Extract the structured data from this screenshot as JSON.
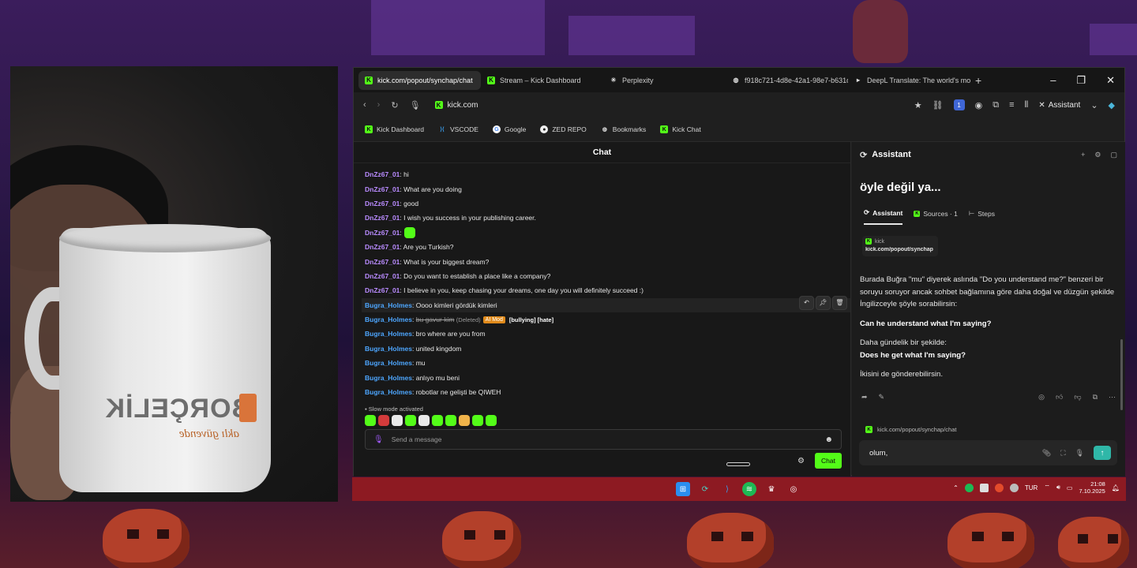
{
  "browser": {
    "tabs": [
      {
        "label": "kick.com/popout/synchap/chat",
        "active": true,
        "icon": "kick-icon"
      },
      {
        "label": "Stream – Kick Dashboard",
        "active": false,
        "icon": "kick-icon"
      },
      {
        "label": "Perplexity",
        "active": false,
        "icon": "perplexity-icon"
      },
      {
        "label": "f918c721-4d8e-42a1-98e7-b631d4",
        "active": false,
        "icon": "globe-icon"
      },
      {
        "label": "DeepL Translate: The world's most a",
        "active": false,
        "icon": "deepl-icon"
      }
    ],
    "url": "kick.com",
    "assistant_button": "Assistant",
    "extension_badge": "1",
    "bookmarks": [
      {
        "label": "Kick Dashboard",
        "icon": "kick-icon"
      },
      {
        "label": "VSCODE",
        "icon": "vscode-icon"
      },
      {
        "label": "Google",
        "icon": "google-icon"
      },
      {
        "label": "ZED REPO",
        "icon": "github-icon"
      },
      {
        "label": "Bookmarks",
        "icon": "globe-icon"
      },
      {
        "label": "Kick Chat",
        "icon": "kick-icon"
      }
    ]
  },
  "chat": {
    "title": "Chat",
    "messages": [
      {
        "user": "DnZz67_01",
        "text": ": hi"
      },
      {
        "user": "DnZz67_01",
        "text": ": What are you doing"
      },
      {
        "user": "DnZz67_01",
        "text": ": good"
      },
      {
        "user": "DnZz67_01",
        "text": ": I wish you success in your publishing career."
      },
      {
        "user": "DnZz67_01",
        "text": ":"
      },
      {
        "user": "DnZz67_01",
        "text": ": Are you Turkish?"
      },
      {
        "user": "DnZz67_01",
        "text": ": What is your biggest dream?"
      },
      {
        "user": "DnZz67_01",
        "text": ": Do you want to establish a place like a company?"
      },
      {
        "user": "DnZz67_01",
        "text": ": I believe in you, keep chasing your dreams, one day you will definitely succeed :)"
      },
      {
        "user": "Bugra_Holmes",
        "text": ": Oooo kimleri gördük kimleri"
      },
      {
        "user": "Bugra_Holmes",
        "text": ":"
      },
      {
        "user": "Bugra_Holmes",
        "text": ": bro where are you from"
      },
      {
        "user": "Bugra_Holmes",
        "text": ": united kingdom"
      },
      {
        "user": "Bugra_Holmes",
        "text": ": mu"
      },
      {
        "user": "Bugra_Holmes",
        "text": ": anlıyo mu beni"
      },
      {
        "user": "Bugra_Holmes",
        "text": ": robotlar ne gelişti be QIWEH"
      }
    ],
    "deleted_text": "bu gavur kim",
    "deleted_label": "(Deleted)",
    "mod_badge": "AI Mod",
    "mod_tags": "[bullying] [hate]",
    "slow_mode": "Slow mode activated",
    "input_placeholder": "Send a message",
    "send_label": "Chat"
  },
  "assistant": {
    "header": "Assistant",
    "title": "öyle değil ya...",
    "tabs": [
      {
        "label": "Assistant",
        "active": true
      },
      {
        "label": "Sources · 1",
        "active": false
      },
      {
        "label": "Steps",
        "active": false
      }
    ],
    "source_site": "kick",
    "source_url": "kick.com/popout/synchap",
    "answer_p1": "Burada Buğra \"mu\" diyerek aslında \"Do you understand me?\" benzeri bir soruyu soruyor ancak sohbet bağlamına göre daha doğal ve düzgün şekilde İngilizceyle şöyle sorabilirsin:",
    "answer_q1": "Can he understand what I'm saying?",
    "answer_p2": "Daha gündelik bir şekilde:",
    "answer_q2": "Does he get what I'm saying?",
    "answer_p3": "İkisini de gönderebilirsin.",
    "context_url": "kick.com/popout/synchap/chat",
    "input_value": "olum,"
  },
  "webcam": {
    "mug_brand": "BORÇELİK",
    "mug_slogan": "aklı güvende"
  },
  "taskbar": {
    "lang": "TUR",
    "time": "21:08",
    "date": "7.10.2025"
  },
  "colors": {
    "kick_green": "#53fc18",
    "user_purple": "#b98bff",
    "user_blue": "#4da6ff",
    "taskbar": "#8d1a22",
    "mod_orange": "#e08a1b",
    "send_teal": "#2fb7a8"
  }
}
